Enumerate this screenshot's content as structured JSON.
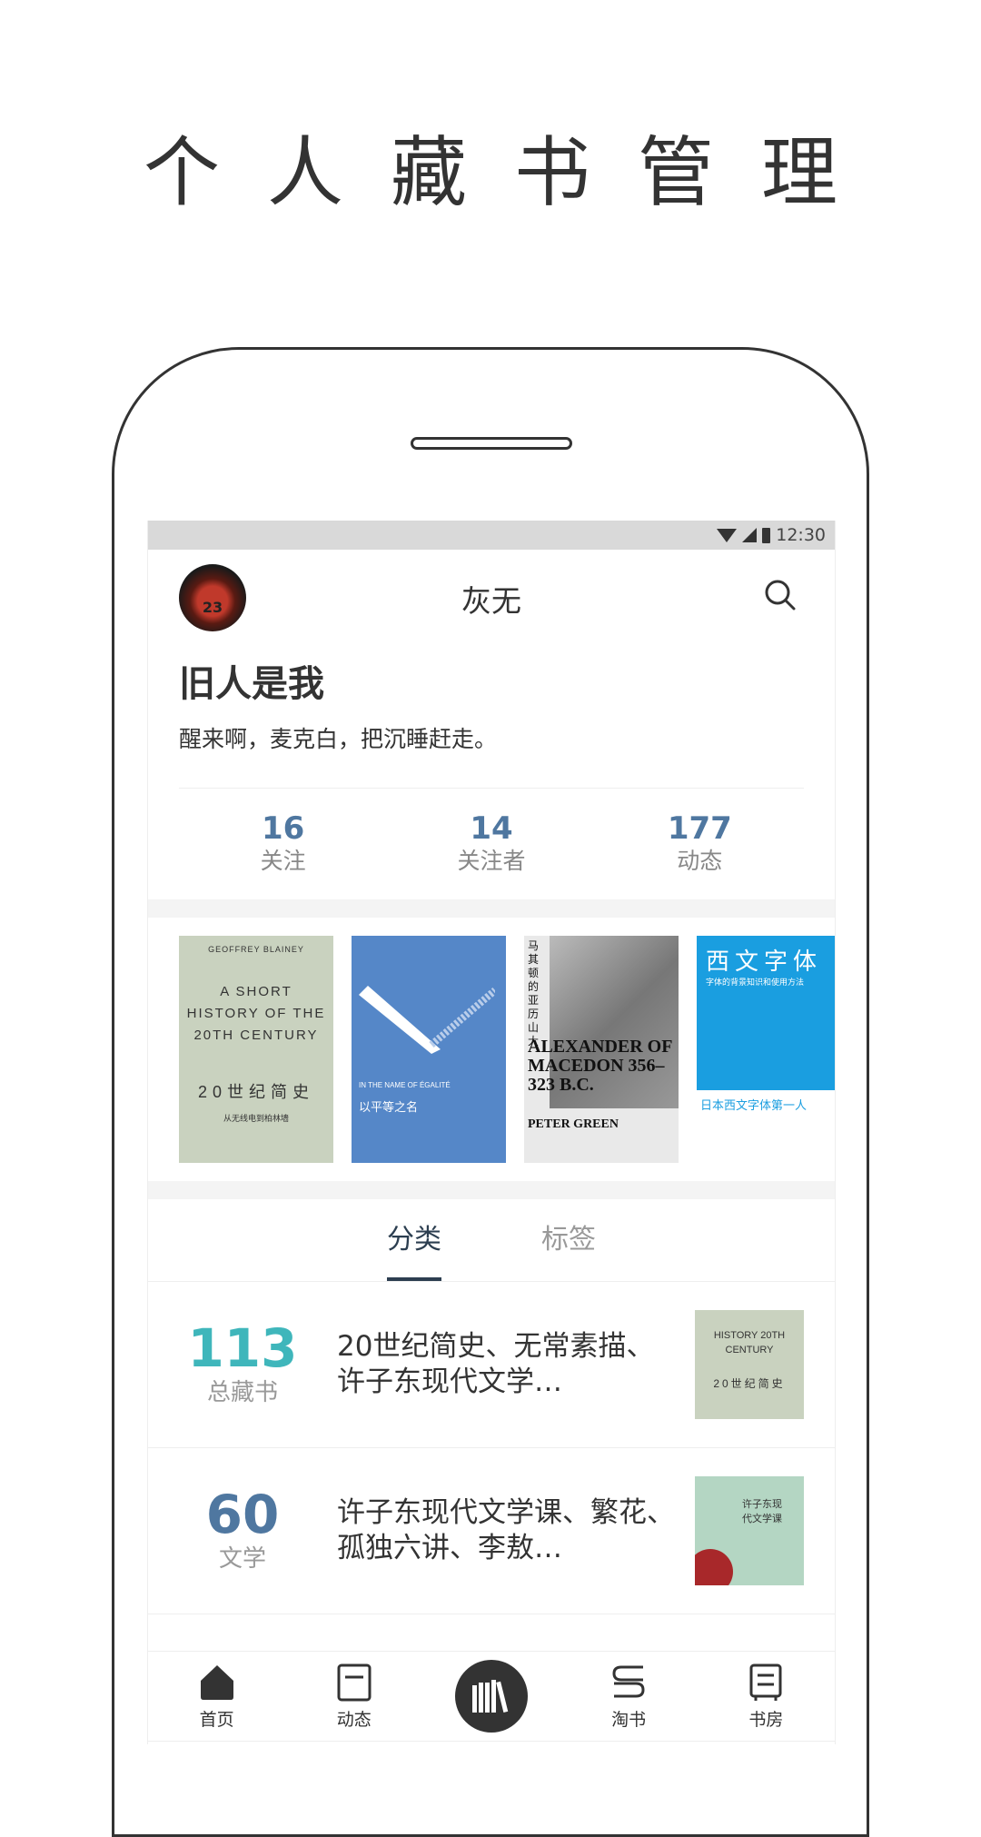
{
  "promo": {
    "title": "个人藏书管理"
  },
  "statusbar": {
    "time": "12:30",
    "icons": [
      "wifi-icon",
      "signal-icon",
      "battery-icon"
    ]
  },
  "header": {
    "title": "灰无",
    "avatar_number": "23",
    "search_icon": "search-icon"
  },
  "profile": {
    "name": "旧人是我",
    "bio": "醒来啊，麦克白，把沉睡赶走。"
  },
  "stats": [
    {
      "value": "16",
      "label": "关注"
    },
    {
      "value": "14",
      "label": "关注者"
    },
    {
      "value": "177",
      "label": "动态"
    }
  ],
  "books": [
    {
      "author": "GEOFFREY BLAINEY",
      "title_en": "A SHORT HISTORY OF THE 20TH CENTURY",
      "title_cn": "20世纪简史",
      "subtitle": "从无线电到柏林墙"
    },
    {
      "title_en": "IN THE NAME OF ÉGALITÉ",
      "title_cn": "以平等之名"
    },
    {
      "title_cn": "马其顿的亚历山大",
      "title_en": "ALEXANDER OF MACEDON 356–323 B.C.",
      "author": "PETER GREEN"
    },
    {
      "title_cn": "西文字体",
      "subtitle": "字体的背景知识和使用方法",
      "tagline": "日本西文字体第一人"
    }
  ],
  "tabs": [
    {
      "label": "分类",
      "active": true
    },
    {
      "label": "标签",
      "active": false
    }
  ],
  "categories": [
    {
      "count": "113",
      "label": "总藏书",
      "color": "#3fb6bb",
      "books": "20世纪简史、无常素描、许子东现代文学…",
      "thumb": {
        "title_en": "HISTORY 20TH CENTURY",
        "title_cn": "20世纪简史",
        "color": "#c9d2bf"
      }
    },
    {
      "count": "60",
      "label": "文学",
      "color": "#4f77a0",
      "books": "许子东现代文学课、繁花、孤独六讲、李敖…",
      "thumb": {
        "title_cn": "许子东现代文学课",
        "color": "#b4d6c3"
      }
    }
  ],
  "tabbar": [
    {
      "label": "首页",
      "icon": "home-icon"
    },
    {
      "label": "动态",
      "icon": "feed-icon"
    },
    {
      "label": "",
      "icon": "bookshelf-icon"
    },
    {
      "label": "淘书",
      "icon": "book-shop-icon"
    },
    {
      "label": "书房",
      "icon": "study-icon"
    }
  ]
}
